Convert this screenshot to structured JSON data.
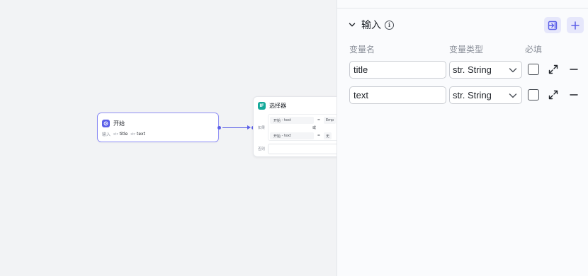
{
  "canvas": {
    "start_node": {
      "icon": "start-icon",
      "title": "开始",
      "inputs_label": "输入",
      "inputs": [
        {
          "type_tag": "str",
          "name": "title"
        },
        {
          "type_tag": "str",
          "name": "text"
        }
      ]
    },
    "selector_node": {
      "icon": "if-icon",
      "icon_text": "IF",
      "title": "选择器",
      "if_label": "如果",
      "else_label": "否则",
      "or_label": "或",
      "conditions": [
        {
          "source": "开始",
          "sep": "-",
          "var": "text",
          "op": "=",
          "value": "Emp"
        },
        {
          "source": "开始",
          "sep": "-",
          "var": "text",
          "op": "=",
          "value": "无"
        }
      ]
    }
  },
  "panel": {
    "section_title": "输入",
    "info_icon": "info-icon",
    "info_glyph": "i",
    "columns": {
      "name": "变量名",
      "type": "变量类型",
      "required": "必填"
    },
    "variables": [
      {
        "name": "title",
        "type": "str. String",
        "required": false
      },
      {
        "name": "text",
        "type": "str. String",
        "required": false
      }
    ]
  },
  "colors": {
    "accent": "#5b5fe8",
    "if_icon": "#14a99a",
    "button_bg": "#e6e7fb",
    "canvas_bg": "#f2f3f5",
    "panel_bg": "#fafbfd"
  }
}
